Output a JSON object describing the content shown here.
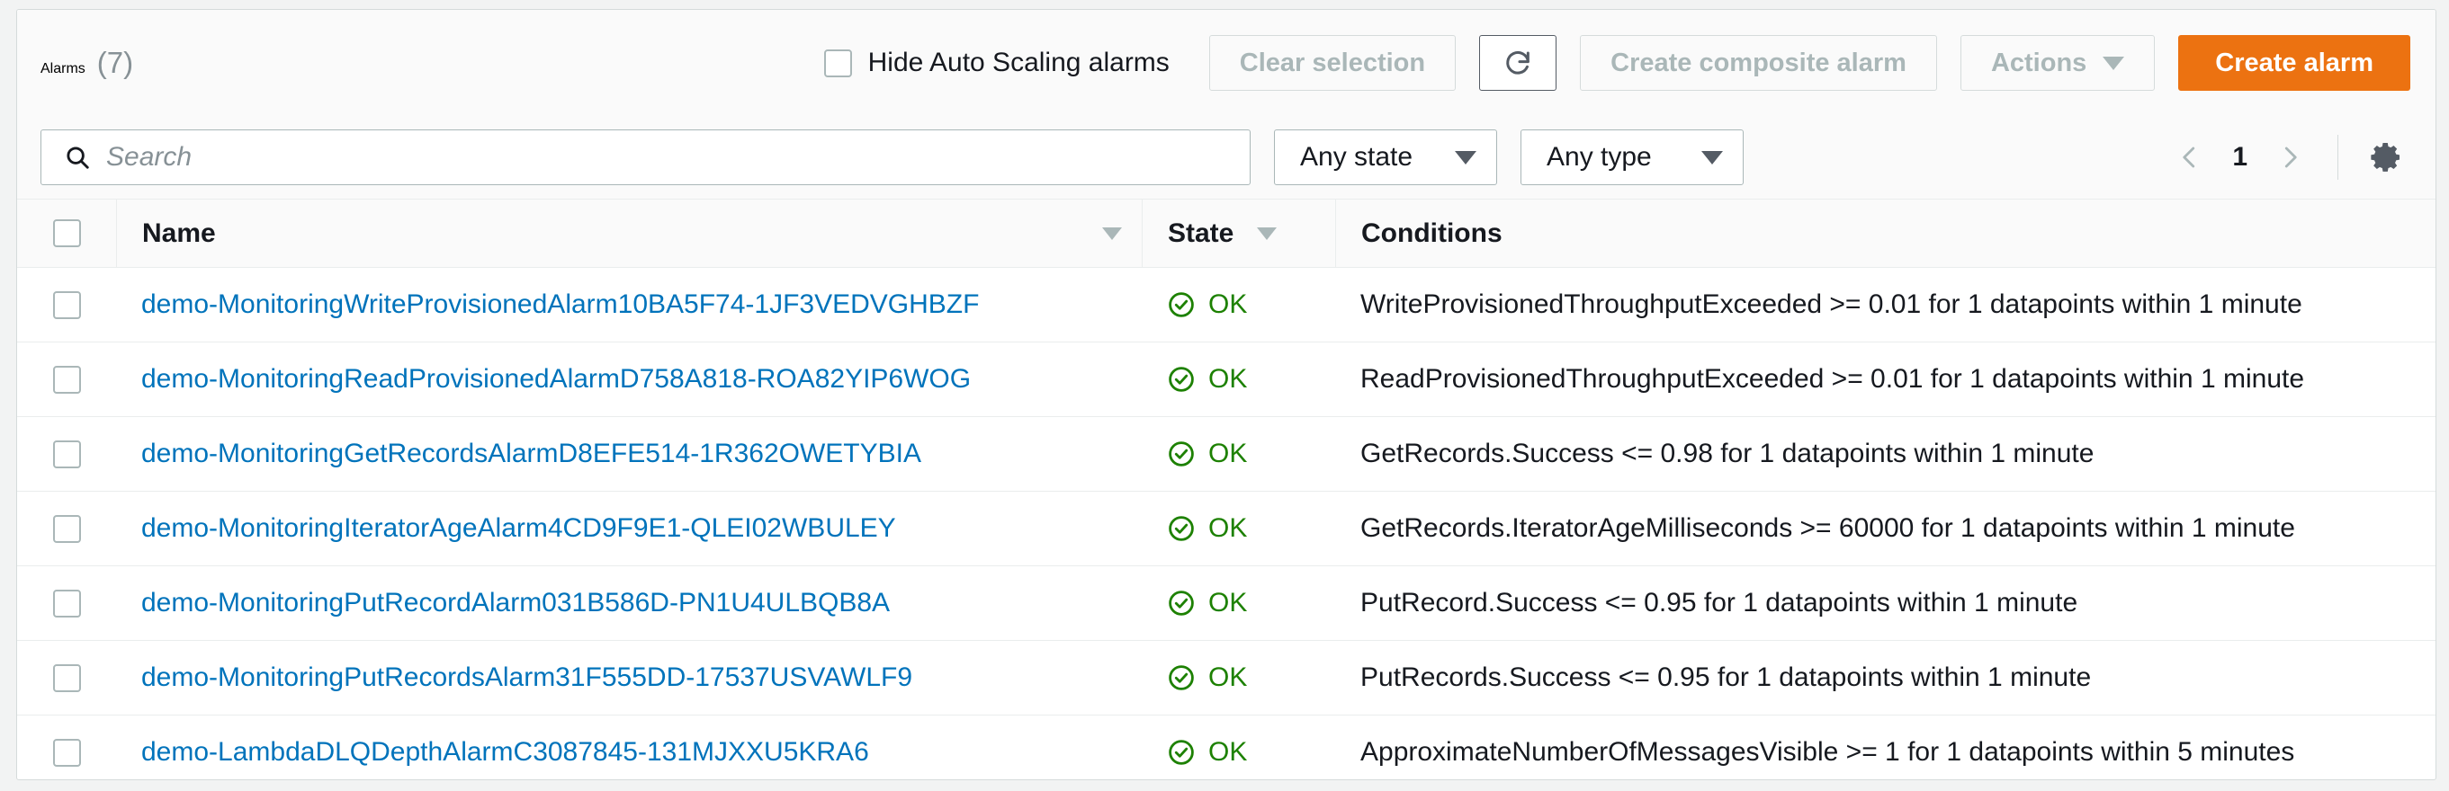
{
  "header": {
    "title": "Alarms",
    "count": "(7)",
    "hide_autoscaling_label": "Hide Auto Scaling alarms",
    "clear_selection_label": "Clear selection",
    "refresh_icon": "refresh-icon",
    "create_composite_label": "Create composite alarm",
    "actions_label": "Actions",
    "create_alarm_label": "Create alarm"
  },
  "filters": {
    "search_placeholder": "Search",
    "search_value": "",
    "search_icon": "search-icon",
    "state_filter": "Any state",
    "type_filter": "Any type",
    "page_number": "1",
    "prev_icon": "chevron-left-icon",
    "next_icon": "chevron-right-icon",
    "settings_icon": "gear-icon"
  },
  "table": {
    "columns": {
      "name": "Name",
      "state": "State",
      "conditions": "Conditions"
    },
    "rows": [
      {
        "name": "demo-MonitoringWriteProvisionedAlarm10BA5F74-1JF3VEDVGHBZF",
        "state": "OK",
        "conditions": "WriteProvisionedThroughputExceeded >= 0.01 for 1 datapoints within 1 minute"
      },
      {
        "name": "demo-MonitoringReadProvisionedAlarmD758A818-ROA82YIP6WOG",
        "state": "OK",
        "conditions": "ReadProvisionedThroughputExceeded >= 0.01 for 1 datapoints within 1 minute"
      },
      {
        "name": "demo-MonitoringGetRecordsAlarmD8EFE514-1R362OWETYBIA",
        "state": "OK",
        "conditions": "GetRecords.Success <= 0.98 for 1 datapoints within 1 minute"
      },
      {
        "name": "demo-MonitoringIteratorAgeAlarm4CD9F9E1-QLEI02WBULEY",
        "state": "OK",
        "conditions": "GetRecords.IteratorAgeMilliseconds >= 60000 for 1 datapoints within 1 minute"
      },
      {
        "name": "demo-MonitoringPutRecordAlarm031B586D-PN1U4ULBQB8A",
        "state": "OK",
        "conditions": "PutRecord.Success <= 0.95 for 1 datapoints within 1 minute"
      },
      {
        "name": "demo-MonitoringPutRecordsAlarm31F555DD-17537USVAWLF9",
        "state": "OK",
        "conditions": "PutRecords.Success <= 0.95 for 1 datapoints within 1 minute"
      },
      {
        "name": "demo-LambdaDLQDepthAlarmC3087845-131MJXXU5KRA6",
        "state": "OK",
        "conditions": "ApproximateNumberOfMessagesVisible >= 1 for 1 datapoints within 5 minutes"
      }
    ]
  },
  "colors": {
    "primary_button": "#ec7211",
    "link": "#0073bb",
    "state_ok": "#1d8102"
  }
}
